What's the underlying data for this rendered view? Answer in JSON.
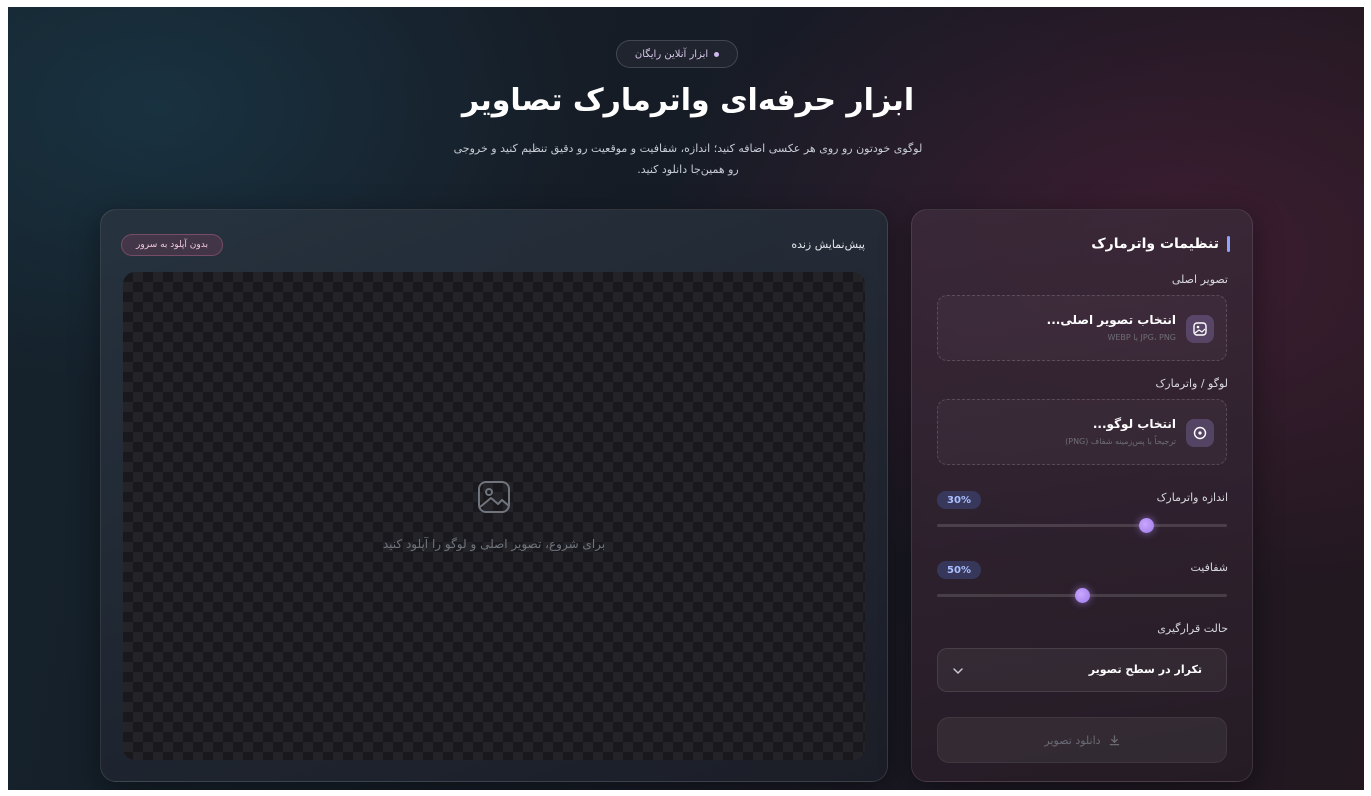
{
  "hero": {
    "badge": "ابزار آنلاین رایگان",
    "title": "ابزار حرفه‌ای واترمارک تصاویر",
    "subtitle": "لوگوی خودتون رو روی هر عکسی اضافه کنید؛ اندازه، شفافیت و موقعیت رو دقیق تنظیم کنید و خروجی رو همین‌جا دانلود کنید."
  },
  "preview": {
    "label": "پیش‌نمایش زنده",
    "no_upload_badge": "بدون آپلود به سرور",
    "placeholder_text": "برای شروع، تصویر اصلی و لوگو را آپلود کنید",
    "placeholder_icon": "image-icon"
  },
  "settings": {
    "title": "تنظیمات واترمارک",
    "main_image": {
      "label": "تصویر اصلی",
      "button_title": "انتخاب تصویر اصلی...",
      "hint": "JPG، PNG یا WEBP",
      "icon": "image-icon"
    },
    "logo": {
      "label": "لوگو / واترمارک",
      "button_title": "انتخاب لوگو...",
      "hint": "ترجیحاً با پس‌زمینه شفاف (PNG)",
      "icon": "plus-circle-icon"
    },
    "size": {
      "label": "اندازه واترمارک",
      "value_text": "30%",
      "fraction": 0.72
    },
    "opacity": {
      "label": "شفافیت",
      "value_text": "50%",
      "fraction": 0.5
    },
    "placement": {
      "label": "حالت قرارگیری",
      "selected": "تکرار در سطح تصویر"
    },
    "download": {
      "label": "دانلود تصویر",
      "icon": "download-icon"
    }
  },
  "colors": {
    "accent": "#8fa3ff",
    "slider_thumb": "#b894ff",
    "badge_pink": "#f0c8da"
  }
}
